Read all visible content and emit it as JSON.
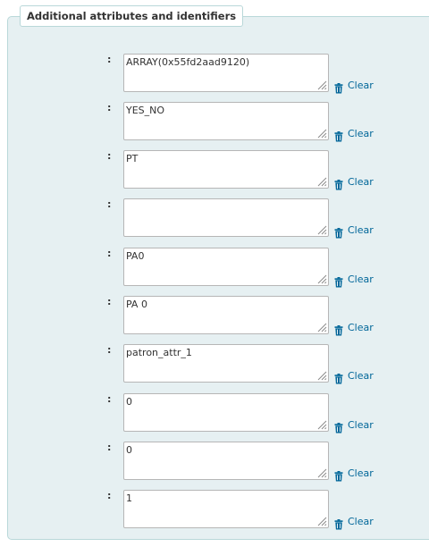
{
  "fieldset": {
    "legend": "Additional attributes and identifiers"
  },
  "attributes": [
    {
      "label": ":",
      "value": "ARRAY(0x55fd2aad9120)",
      "clear_label": "Clear"
    },
    {
      "label": ":",
      "value": "YES_NO",
      "clear_label": "Clear"
    },
    {
      "label": ":",
      "value": "PT",
      "clear_label": "Clear"
    },
    {
      "label": ":",
      "value": "",
      "clear_label": "Clear"
    },
    {
      "label": ":",
      "value": "PA0",
      "clear_label": "Clear"
    },
    {
      "label": ":",
      "value": "PA 0",
      "clear_label": "Clear"
    },
    {
      "label": ":",
      "value": "patron_attr_1",
      "clear_label": "Clear"
    },
    {
      "label": ":",
      "value": "0",
      "clear_label": "Clear"
    },
    {
      "label": ":",
      "value": "0",
      "clear_label": "Clear"
    },
    {
      "label": ":",
      "value": "1",
      "clear_label": "Clear"
    }
  ],
  "icons": {
    "clear": "trash-icon",
    "resize": "resize-grip-icon"
  },
  "colors": {
    "fieldset_background": "#e6f0f2",
    "fieldset_border": "#b9d8d9",
    "link": "#006699",
    "text": "#333333"
  }
}
